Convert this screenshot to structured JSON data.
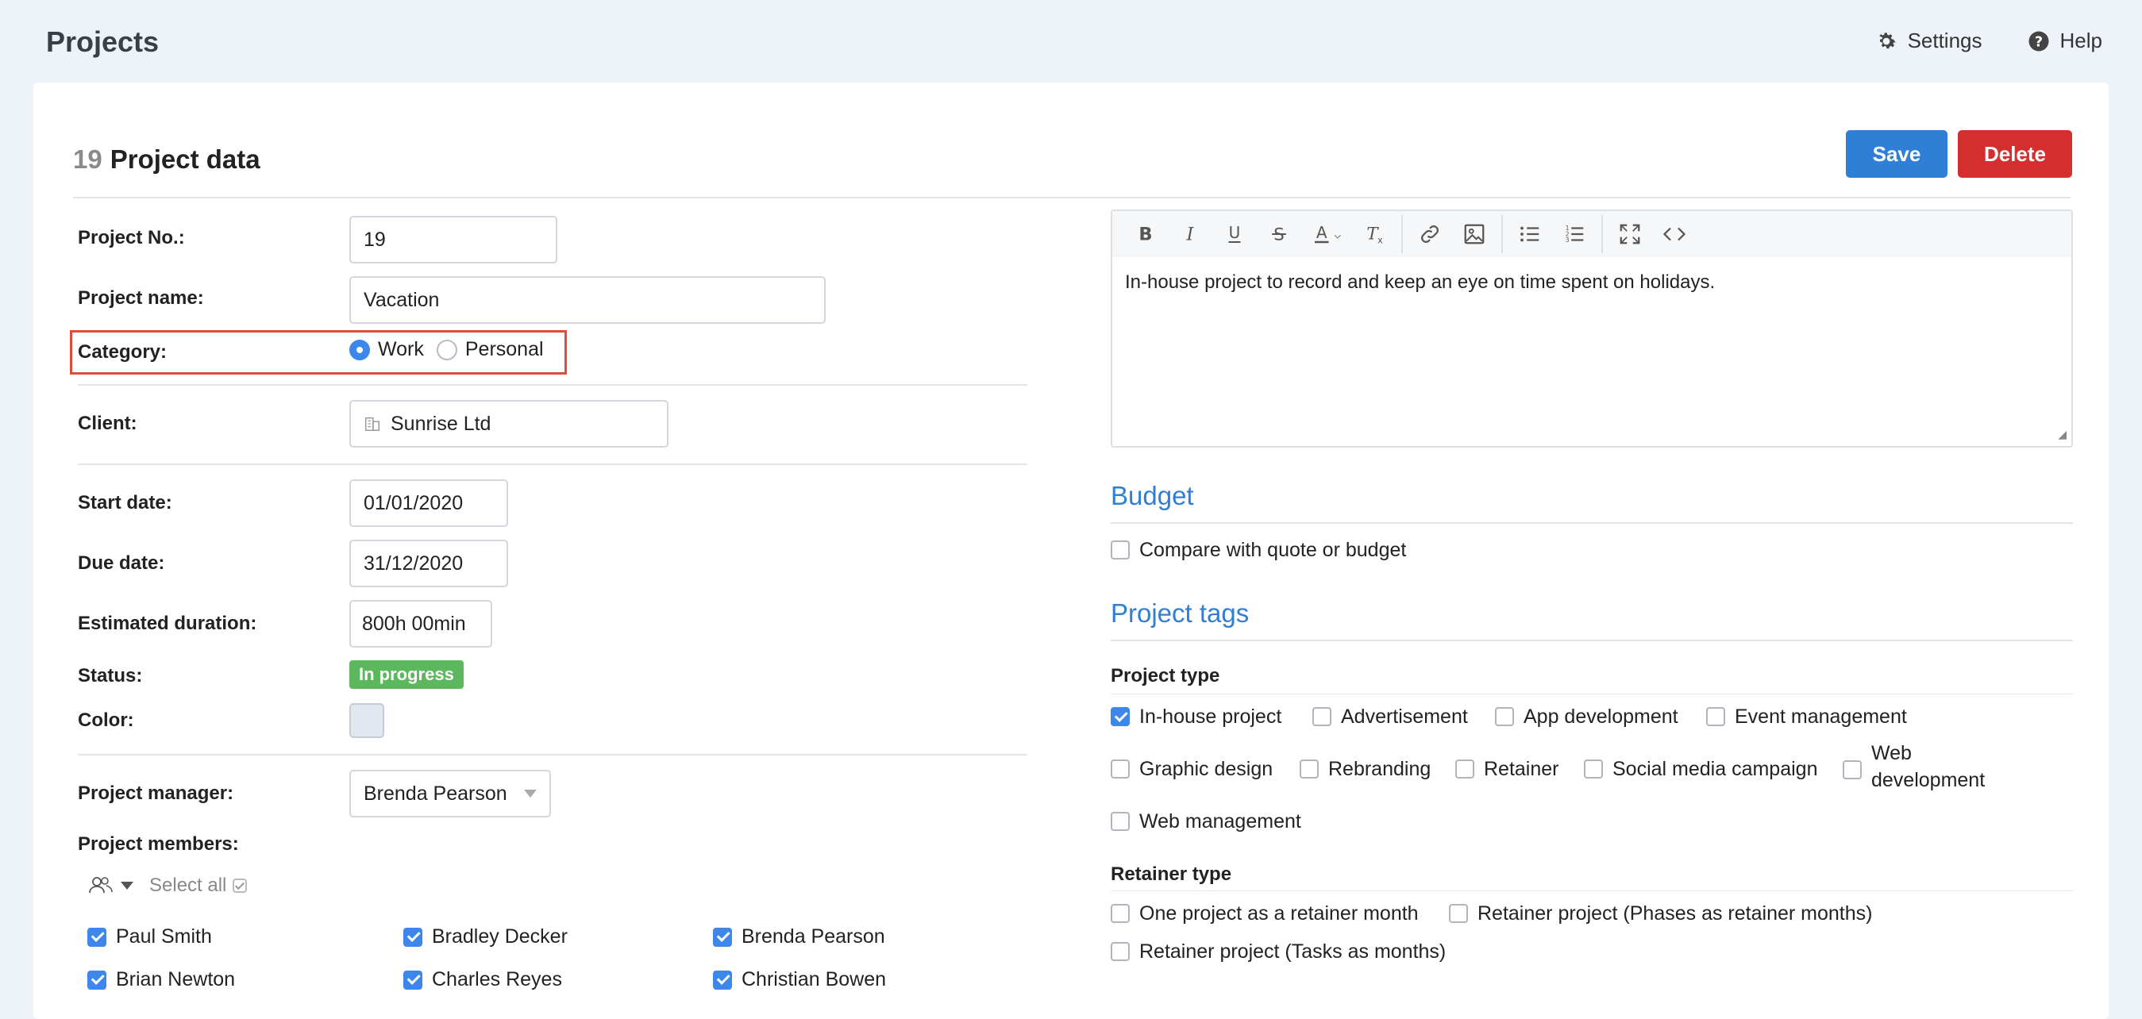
{
  "header": {
    "app_title": "Projects",
    "settings_label": "Settings",
    "help_label": "Help"
  },
  "page": {
    "number": "19",
    "title": "Project data",
    "save_label": "Save",
    "delete_label": "Delete"
  },
  "form": {
    "project_no_label": "Project No.:",
    "project_no_value": "19",
    "project_name_label": "Project name:",
    "project_name_value": "Vacation",
    "category_label": "Category:",
    "category_options": [
      "Work",
      "Personal"
    ],
    "category_selected": "Work",
    "client_label": "Client:",
    "client_value": "Sunrise Ltd",
    "start_date_label": "Start date:",
    "start_date_value": "01/01/2020",
    "due_date_label": "Due date:",
    "due_date_value": "31/12/2020",
    "estimated_duration_label": "Estimated duration:",
    "estimated_duration_value": "800h 00min",
    "status_label": "Status:",
    "status_value": "In progress",
    "color_label": "Color:",
    "color_value": "#e2e7f0",
    "project_manager_label": "Project manager:",
    "project_manager_value": "Brenda Pearson",
    "project_members_label": "Project members:",
    "select_all_label": "Select all",
    "members": [
      "Paul Smith",
      "Bradley Decker",
      "Brenda Pearson",
      "Brian Newton",
      "Charles Reyes",
      "Christian Bowen"
    ]
  },
  "editor": {
    "content": "In-house project to record and keep an eye on time spent on holidays."
  },
  "budget": {
    "title": "Budget",
    "compare_label": "Compare with quote or budget"
  },
  "tags": {
    "title": "Project tags",
    "project_type_label": "Project type",
    "project_types": [
      "In-house project",
      "Advertisement",
      "App development",
      "Event management",
      "Graphic design",
      "Rebranding",
      "Retainer",
      "Social media campaign",
      "Web development",
      "Web management"
    ],
    "retainer_type_label": "Retainer type",
    "retainer_types": [
      "One project as a retainer month",
      "Retainer project (Phases as retainer months)",
      "Retainer project (Tasks as months)"
    ]
  },
  "colors": {
    "accent": "#2f7fd6",
    "save": "#2f7fd6",
    "delete": "#d32f2f",
    "status": "#5cb85c",
    "highlight": "#e24a3b"
  }
}
